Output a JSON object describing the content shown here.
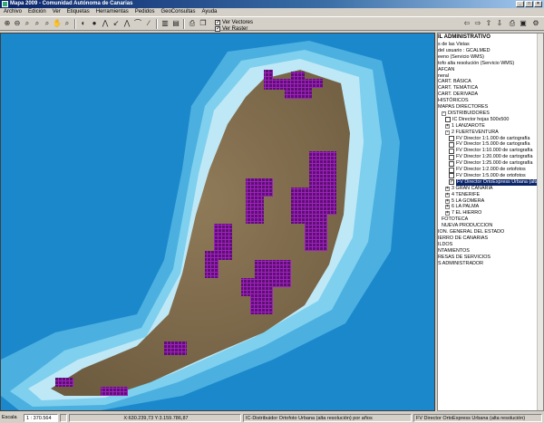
{
  "window": {
    "title": "Mapa  2009 - Comunidad Autónoma de Canarias",
    "minimize": "_",
    "maximize": "□",
    "close": "×"
  },
  "menu": [
    "Archivo",
    "Edición",
    "Ver",
    "Etiquetas",
    "Herramientas",
    "Pedidos",
    "GeoConsultas",
    "Ayuda"
  ],
  "toolbar": {
    "left_icons": [
      "zoom-in-icon",
      "zoom-out-icon",
      "zoom-window-icon",
      "zoom-prev-icon",
      "zoom-next-icon",
      "pan-hand-icon",
      "zoom-extent-icon",
      "info-icon",
      "measure-icon",
      "profile-icon",
      "shovel-icon",
      "select-icon",
      "print-icon",
      "copy-icon",
      "export-icon"
    ],
    "ver_vectores": "Ver Vectores",
    "ver_raster": "Ver Raster",
    "ver_vectores_checked": true,
    "ver_raster_checked": true,
    "right_icons": [
      "back-icon",
      "forward-icon",
      "up-icon",
      "down-icon",
      "print-icon",
      "save-icon",
      "settings-icon",
      "refresh-icon"
    ]
  },
  "panel": {
    "title": "IL ADMINISTRATIVO",
    "rows": [
      {
        "text": "s de las Vistas",
        "indent": 0
      },
      {
        "text": "del usuario : GCALMED",
        "indent": 0
      },
      {
        "text": "eeno (Servicio WMS)",
        "indent": 0
      },
      {
        "text": "tofo alta resolución (Servicio WMS)",
        "indent": 0
      },
      {
        "text": "AFCAN",
        "indent": 0
      },
      {
        "text": "neral",
        "indent": 0
      },
      {
        "text": "CART. BÁSICA",
        "indent": 0
      },
      {
        "text": "CART. TEMÁTICA",
        "indent": 0
      },
      {
        "text": "CART. DERIVADA",
        "indent": 0
      },
      {
        "text": "HISTÓRICOS",
        "indent": 0
      },
      {
        "text": "MAPAS DIRECTORES",
        "indent": 0
      },
      {
        "text": "DISTRIBUIDORES",
        "indent": 1,
        "box": "-"
      },
      {
        "text": "IC Director hojas 500x500",
        "indent": 2,
        "check": ""
      },
      {
        "text": "1 LANZAROTE",
        "indent": 2,
        "box": "+"
      },
      {
        "text": "2 FUERTEVENTURA",
        "indent": 2,
        "box": "-"
      },
      {
        "text": "FV Director 1:1.000 de cartografía",
        "indent": 3,
        "check": ""
      },
      {
        "text": "FV Director 1:5.000 de cartografía",
        "indent": 3,
        "check": ""
      },
      {
        "text": "FV Director 1:10.000 de cartografía",
        "indent": 3,
        "check": ""
      },
      {
        "text": "FV Director 1:20.000 de cartografía",
        "indent": 3,
        "check": ""
      },
      {
        "text": "FV Director 1:25.000 de cartografía",
        "indent": 3,
        "check": ""
      },
      {
        "text": "FV Director 1:2.000 de ortofotos",
        "indent": 3,
        "check": ""
      },
      {
        "text": "FV Director 1:5.000 de ortofotos",
        "indent": 3,
        "check": ""
      },
      {
        "text": "FV Director OrtoExpress Urbana (alta resol",
        "indent": 3,
        "check": "✓",
        "selected": true
      },
      {
        "text": "3 GRAN CANARIA",
        "indent": 2,
        "box": "+"
      },
      {
        "text": "4 TENERIFE",
        "indent": 2,
        "box": "+"
      },
      {
        "text": "5 LA GOMERA",
        "indent": 2,
        "box": "+"
      },
      {
        "text": "6 LA PALMA",
        "indent": 2,
        "box": "+"
      },
      {
        "text": "7 EL HIERRO",
        "indent": 2,
        "box": "+"
      },
      {
        "text": "FOTOTECA",
        "indent": 1
      },
      {
        "text": "NUEVA PRODUCCION",
        "indent": 1
      },
      {
        "text": "ION. GENERAL DEL ESTADO",
        "indent": 0
      },
      {
        "text": "IERRO DE CANARIAS",
        "indent": 0
      },
      {
        "text": "ILDOS",
        "indent": 0
      },
      {
        "text": "NTAMIENTOS",
        "indent": 0
      },
      {
        "text": "RESAS DE SERVICIOS",
        "indent": 0
      },
      {
        "text": "S ADMINISTRADOR",
        "indent": 0
      }
    ]
  },
  "status": {
    "scale_label": "Escala",
    "scale_value": "1 : 370.564",
    "coords": "X:630.239,73  Y:3.159.786,87",
    "layer": "IC-Distribuidor Ortofoto Urbana (alta resolución) por años",
    "active": "FV Director OrtoExpress Urbana (alta resolución)"
  },
  "colors": {
    "sea_deep": "#1e8cd0",
    "sea_shallow": "#7fd4ee",
    "land": "#8a7352",
    "grid_cells": "#a020c0"
  }
}
